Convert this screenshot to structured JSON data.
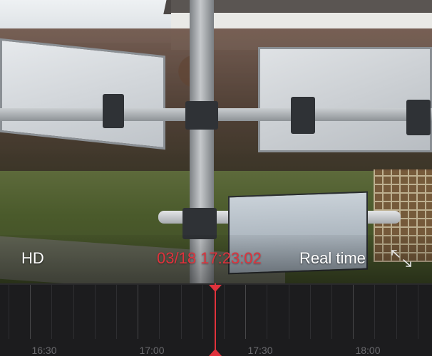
{
  "player": {
    "quality_label": "HD",
    "timestamp": "03/18 17:23:02",
    "mode_label": "Real time",
    "fullscreen_icon": "expand-arrows-icon"
  },
  "timeline": {
    "labels": [
      "16:30",
      "17:00",
      "17:30",
      "18:00"
    ],
    "playhead_time": "17:23:02"
  },
  "colors": {
    "accent": "#e0323c",
    "timeline_bg": "#1c1c1e",
    "label_text": "#6a6a6e",
    "overlay_text": "#ffffff"
  }
}
